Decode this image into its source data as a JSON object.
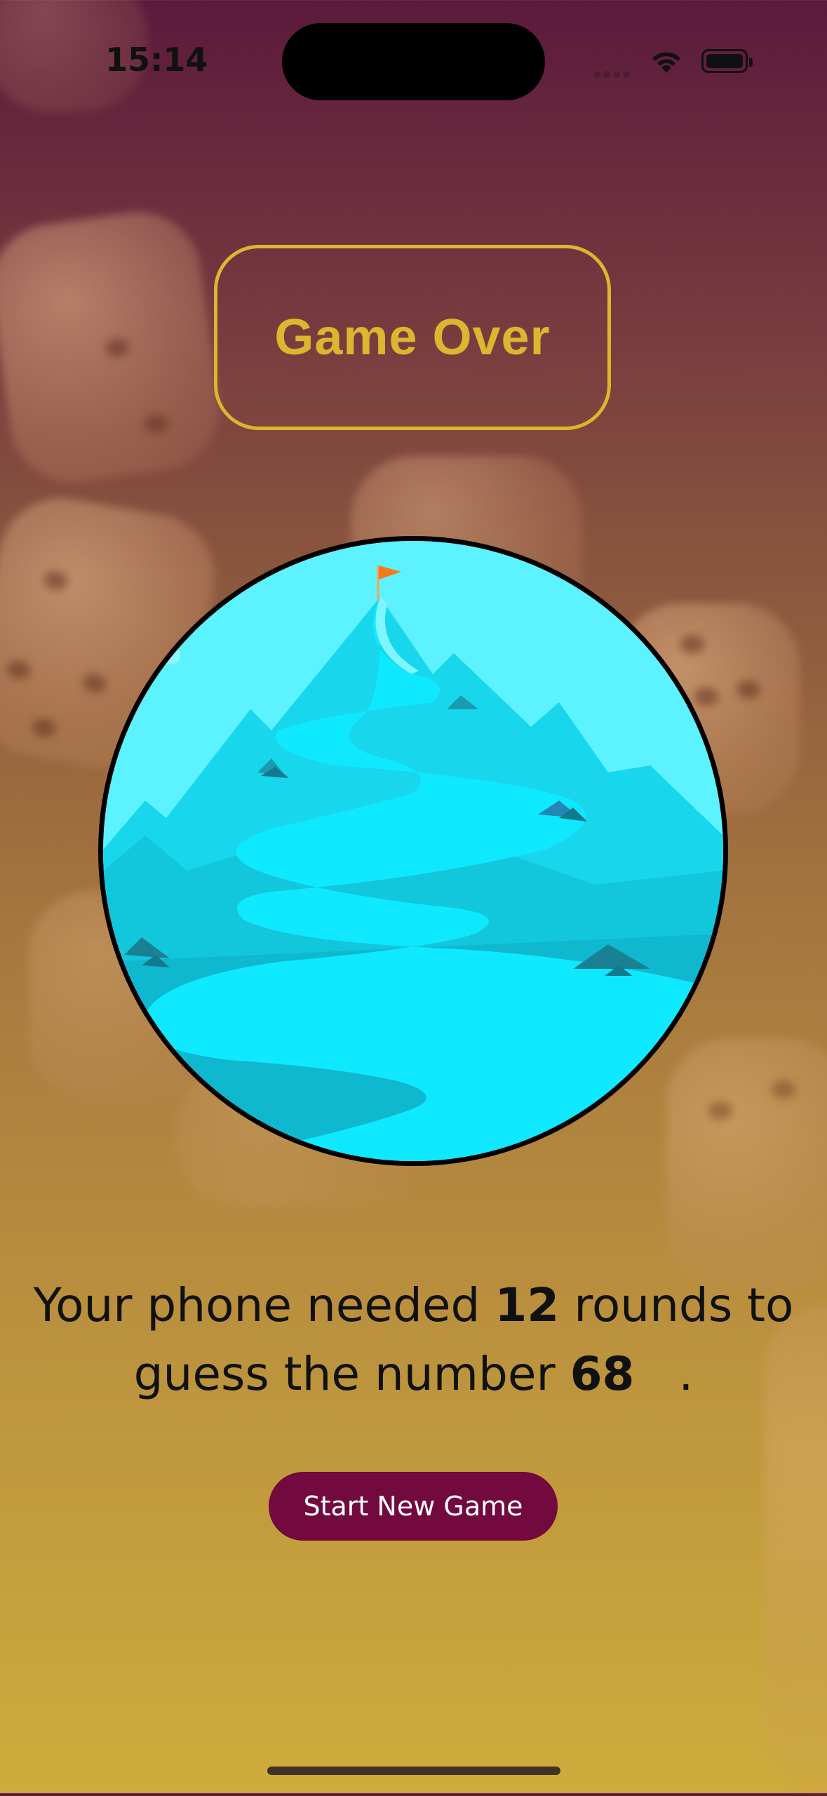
{
  "status_bar": {
    "time": "15:14",
    "icons": [
      "wifi-icon",
      "battery-icon"
    ]
  },
  "title": {
    "text": "Game Over"
  },
  "image": {
    "description_icon": "mountain-flag-illustration"
  },
  "summary": {
    "prefix": "Your phone needed ",
    "rounds": "12",
    "middle": " rounds to guess the number ",
    "number": "68",
    "suffix": "   ."
  },
  "button": {
    "label": "Start New Game"
  },
  "colors": {
    "accent": "#ddb52f",
    "primary": "#72093f",
    "background_top": "#5b1a3c",
    "background_bottom": "#cfac3c"
  }
}
